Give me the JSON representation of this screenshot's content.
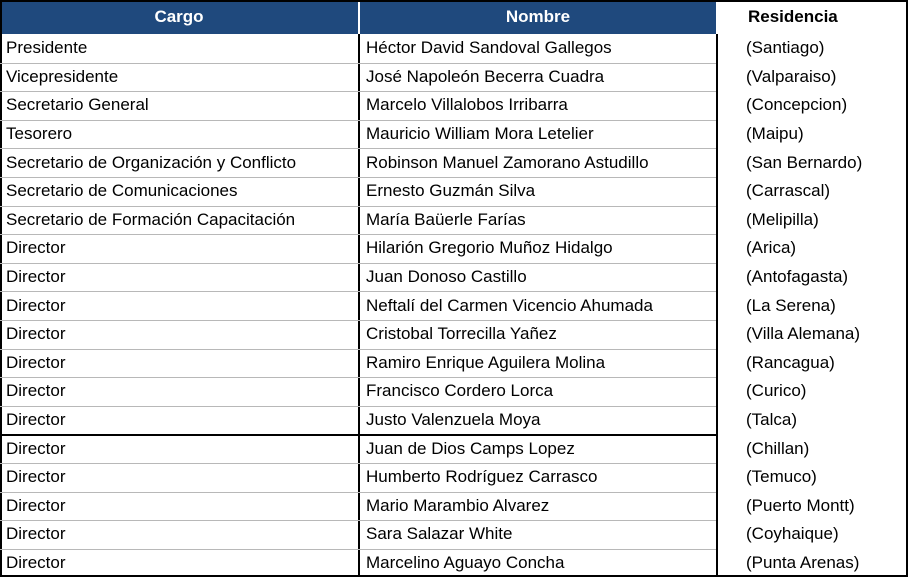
{
  "headers": {
    "cargo": "Cargo",
    "nombre": "Nombre",
    "residencia": "Residencia"
  },
  "header_color": "#1f497d",
  "rows": [
    {
      "cargo": "Presidente",
      "nombre": "Héctor David Sandoval Gallegos",
      "residencia": "(Santiago)"
    },
    {
      "cargo": "Vicepresidente",
      "nombre": "José Napoleón Becerra Cuadra",
      "residencia": "(Valparaiso)"
    },
    {
      "cargo": "Secretario General",
      "nombre": "Marcelo Villalobos Irribarra",
      "residencia": "(Concepcion)"
    },
    {
      "cargo": "Tesorero",
      "nombre": "Mauricio William Mora Letelier",
      "residencia": "(Maipu)"
    },
    {
      "cargo": "Secretario de Organización  y Conflicto",
      "nombre": "Robinson Manuel Zamorano Astudillo",
      "residencia": "(San Bernardo)"
    },
    {
      "cargo": "Secretario de Comunicaciones",
      "nombre": "Ernesto Guzmán Silva",
      "residencia": "(Carrascal)"
    },
    {
      "cargo": "Secretario de Formación Capacitación",
      "nombre": "María Baüerle Farías",
      "residencia": "(Melipilla)"
    },
    {
      "cargo": "Director",
      "nombre": "Hilarión Gregorio Muñoz Hidalgo",
      "residencia": "(Arica)"
    },
    {
      "cargo": "Director",
      "nombre": "Juan Donoso Castillo",
      "residencia": "(Antofagasta)"
    },
    {
      "cargo": "Director",
      "nombre": "Neftalí del Carmen Vicencio Ahumada",
      "residencia": "(La Serena)"
    },
    {
      "cargo": "Director",
      "nombre": "Cristobal Torrecilla Yañez",
      "residencia": "(Villa Alemana)"
    },
    {
      "cargo": "Director",
      "nombre": "Ramiro Enrique Aguilera Molina",
      "residencia": "(Rancagua)"
    },
    {
      "cargo": "Director",
      "nombre": "Francisco Cordero Lorca",
      "residencia": "(Curico)"
    },
    {
      "cargo": "Director",
      "nombre": "Justo Valenzuela Moya",
      "residencia": "(Talca)"
    },
    {
      "cargo": "Director",
      "nombre": "Juan de Dios Camps Lopez",
      "residencia": "(Chillan)"
    },
    {
      "cargo": "Director",
      "nombre": "Humberto Rodríguez Carrasco",
      "residencia": "(Temuco)"
    },
    {
      "cargo": "Director",
      "nombre": "Mario Marambio Alvarez",
      "residencia": "(Puerto Montt)"
    },
    {
      "cargo": "Director",
      "nombre": "Sara Salazar White",
      "residencia": "(Coyhaique)"
    },
    {
      "cargo": "Director",
      "nombre": "Marcelino Aguayo Concha",
      "residencia": "(Punta Arenas)"
    }
  ]
}
